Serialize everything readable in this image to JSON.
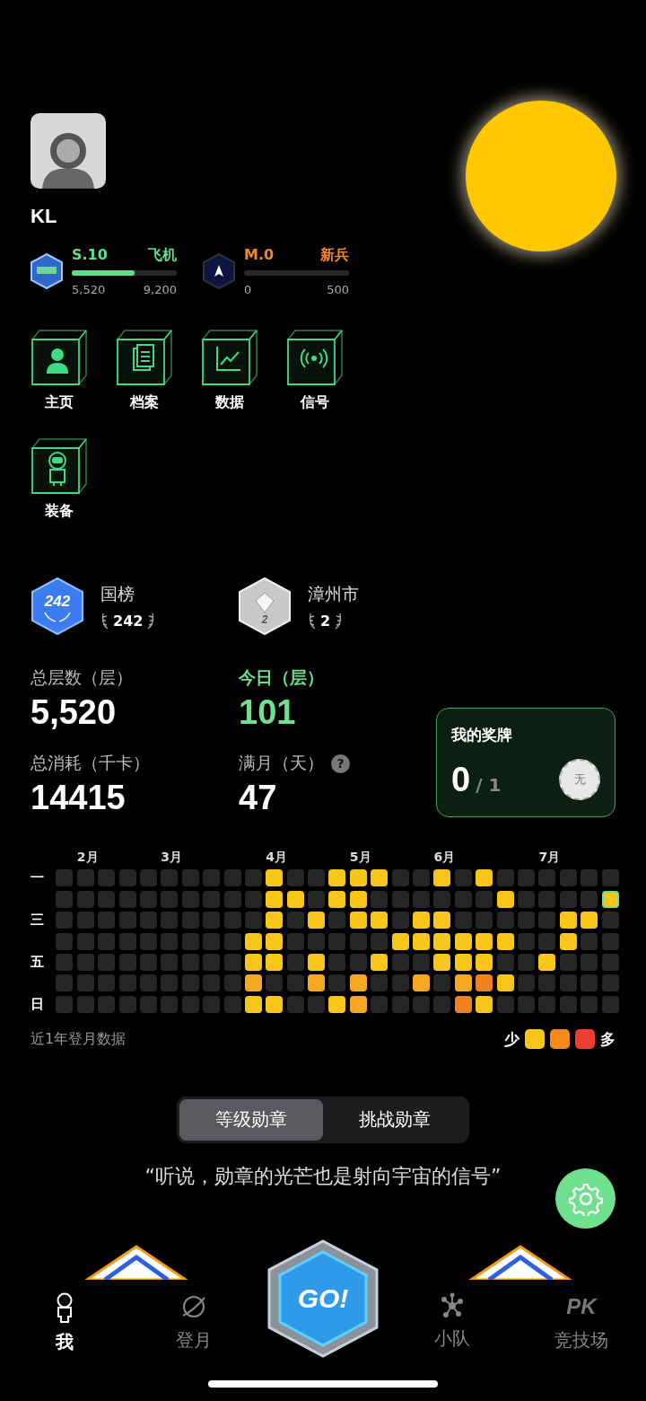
{
  "profile": {
    "name": "KL"
  },
  "levels": [
    {
      "kind": "emblem",
      "code": "S.10",
      "title": "飞机",
      "level": 0.6,
      "current": "5,520",
      "target": "9,200",
      "color": "#5fe08a"
    },
    {
      "kind": "arrow",
      "code": "M.0",
      "title": "新兵",
      "level": 0,
      "current": "0",
      "target": "500",
      "color": "#f08a24"
    }
  ],
  "menu": [
    {
      "kind": "person",
      "label": "主页"
    },
    {
      "kind": "document",
      "label": "档案"
    },
    {
      "kind": "chart",
      "label": "数据"
    },
    {
      "kind": "signal",
      "label": "信号"
    },
    {
      "kind": "astronaut",
      "label": "装备"
    }
  ],
  "rankings": [
    {
      "kind": "blue",
      "title": "国榜",
      "badge_text": "242",
      "rank": "242"
    },
    {
      "kind": "silver",
      "title": "漳州市",
      "badge_text": "2",
      "rank": "2"
    }
  ],
  "stats": [
    {
      "label": "总层数（层）",
      "value": "5,520",
      "highlight": false
    },
    {
      "label": "今日（层）",
      "value": "101",
      "highlight": true
    },
    {
      "label": "总消耗（千卡）",
      "value": "14415",
      "highlight": false
    },
    {
      "label": "满月（天）",
      "value": "47",
      "highlight": false,
      "help_text": "?"
    }
  ],
  "medal_card": {
    "title": "我的奖牌",
    "count": "0",
    "total": "/ 1",
    "medal_text": "无"
  },
  "heatmap": {
    "months": [
      "2月",
      "3月",
      "4月",
      "5月",
      "6月",
      "7月"
    ],
    "rows": [
      {
        "label": "一",
        "today": false,
        "cells": [
          {
            "color": "#262626"
          },
          {
            "color": "#262626"
          },
          {
            "color": "#262626"
          },
          {
            "color": "#262626"
          },
          {
            "color": "#262626"
          },
          {
            "color": "#262626"
          },
          {
            "color": "#262626"
          },
          {
            "color": "#262626"
          },
          {
            "color": "#262626"
          },
          {
            "color": "#262626"
          },
          {
            "color": "#f8c51b"
          },
          {
            "color": "#262626"
          },
          {
            "color": "#262626"
          },
          {
            "color": "#f8c51b"
          },
          {
            "color": "#f8c51b"
          },
          {
            "color": "#f8c51b"
          },
          {
            "color": "#262626"
          },
          {
            "color": "#262626"
          },
          {
            "color": "#f8c51b"
          },
          {
            "color": "#262626"
          },
          {
            "color": "#f8c51b"
          },
          {
            "color": "#262626"
          },
          {
            "color": "#262626"
          },
          {
            "color": "#262626"
          },
          {
            "color": "#262626"
          },
          {
            "color": "#262626"
          },
          {
            "color": "#262626"
          }
        ]
      },
      {
        "today": true,
        "cells": [
          {
            "color": "#262626"
          },
          {
            "color": "#262626"
          },
          {
            "color": "#262626"
          },
          {
            "color": "#262626"
          },
          {
            "color": "#262626"
          },
          {
            "color": "#262626"
          },
          {
            "color": "#262626"
          },
          {
            "color": "#262626"
          },
          {
            "color": "#262626"
          },
          {
            "color": "#262626"
          },
          {
            "color": "#f8c51b"
          },
          {
            "color": "#f8c51b"
          },
          {
            "color": "#262626"
          },
          {
            "color": "#f8c51b"
          },
          {
            "color": "#f8c51b"
          },
          {
            "color": "#262626"
          },
          {
            "color": "#262626"
          },
          {
            "color": "#262626"
          },
          {
            "color": "#262626"
          },
          {
            "color": "#262626"
          },
          {
            "color": "#262626"
          },
          {
            "color": "#f8c51b"
          },
          {
            "color": "#262626"
          },
          {
            "color": "#262626"
          },
          {
            "color": "#262626"
          },
          {
            "color": "#262626"
          },
          {
            "color": "#f8c51b"
          }
        ]
      },
      {
        "label": "三",
        "today": false,
        "cells": [
          {
            "color": "#262626"
          },
          {
            "color": "#262626"
          },
          {
            "color": "#262626"
          },
          {
            "color": "#262626"
          },
          {
            "color": "#262626"
          },
          {
            "color": "#262626"
          },
          {
            "color": "#262626"
          },
          {
            "color": "#262626"
          },
          {
            "color": "#262626"
          },
          {
            "color": "#262626"
          },
          {
            "color": "#f8c51b"
          },
          {
            "color": "#262626"
          },
          {
            "color": "#f8c51b"
          },
          {
            "color": "#262626"
          },
          {
            "color": "#f8c51b"
          },
          {
            "color": "#f8c51b"
          },
          {
            "color": "#262626"
          },
          {
            "color": "#f8c51b"
          },
          {
            "color": "#f8c51b"
          },
          {
            "color": "#262626"
          },
          {
            "color": "#262626"
          },
          {
            "color": "#262626"
          },
          {
            "color": "#262626"
          },
          {
            "color": "#262626"
          },
          {
            "color": "#f8c51b"
          },
          {
            "color": "#f8c51b"
          },
          {
            "color": "#262626"
          }
        ]
      },
      {
        "today": false,
        "cells": [
          {
            "color": "#262626"
          },
          {
            "color": "#262626"
          },
          {
            "color": "#262626"
          },
          {
            "color": "#262626"
          },
          {
            "color": "#262626"
          },
          {
            "color": "#262626"
          },
          {
            "color": "#262626"
          },
          {
            "color": "#262626"
          },
          {
            "color": "#262626"
          },
          {
            "color": "#f8c51b"
          },
          {
            "color": "#f8c51b"
          },
          {
            "color": "#262626"
          },
          {
            "color": "#262626"
          },
          {
            "color": "#262626"
          },
          {
            "color": "#262626"
          },
          {
            "color": "#262626"
          },
          {
            "color": "#f8c51b"
          },
          {
            "color": "#f8c51b"
          },
          {
            "color": "#f8c51b"
          },
          {
            "color": "#f8c51b"
          },
          {
            "color": "#f8c51b"
          },
          {
            "color": "#f8c51b"
          },
          {
            "color": "#262626"
          },
          {
            "color": "#262626"
          },
          {
            "color": "#f8c51b"
          },
          {
            "color": "#262626"
          },
          {
            "color": "#262626"
          }
        ]
      },
      {
        "label": "五",
        "today": false,
        "cells": [
          {
            "color": "#262626"
          },
          {
            "color": "#262626"
          },
          {
            "color": "#262626"
          },
          {
            "color": "#262626"
          },
          {
            "color": "#262626"
          },
          {
            "color": "#262626"
          },
          {
            "color": "#262626"
          },
          {
            "color": "#262626"
          },
          {
            "color": "#262626"
          },
          {
            "color": "#f8c51b"
          },
          {
            "color": "#f8c51b"
          },
          {
            "color": "#262626"
          },
          {
            "color": "#f8c51b"
          },
          {
            "color": "#262626"
          },
          {
            "color": "#262626"
          },
          {
            "color": "#f8c51b"
          },
          {
            "color": "#262626"
          },
          {
            "color": "#262626"
          },
          {
            "color": "#f8c51b"
          },
          {
            "color": "#f8c51b"
          },
          {
            "color": "#f8c51b"
          },
          {
            "color": "#262626"
          },
          {
            "color": "#262626"
          },
          {
            "color": "#f8c51b"
          },
          {
            "color": "#262626"
          },
          {
            "color": "#262626"
          },
          {
            "color": "#262626"
          }
        ]
      },
      {
        "today": false,
        "cells": [
          {
            "color": "#262626"
          },
          {
            "color": "#262626"
          },
          {
            "color": "#262626"
          },
          {
            "color": "#262626"
          },
          {
            "color": "#262626"
          },
          {
            "color": "#262626"
          },
          {
            "color": "#262626"
          },
          {
            "color": "#262626"
          },
          {
            "color": "#262626"
          },
          {
            "color": "#f7a822"
          },
          {
            "color": "#262626"
          },
          {
            "color": "#262626"
          },
          {
            "color": "#f7a822"
          },
          {
            "color": "#262626"
          },
          {
            "color": "#f7a822"
          },
          {
            "color": "#262626"
          },
          {
            "color": "#262626"
          },
          {
            "color": "#f7a822"
          },
          {
            "color": "#262626"
          },
          {
            "color": "#f7a822"
          },
          {
            "color": "#f0801e"
          },
          {
            "color": "#f8c51b"
          },
          {
            "color": "#262626"
          },
          {
            "color": "#262626"
          },
          {
            "color": "#262626"
          },
          {
            "color": "#262626"
          },
          {
            "color": "#262626"
          }
        ]
      },
      {
        "label": "日",
        "today": false,
        "cells": [
          {
            "color": "#262626"
          },
          {
            "color": "#262626"
          },
          {
            "color": "#262626"
          },
          {
            "color": "#262626"
          },
          {
            "color": "#262626"
          },
          {
            "color": "#262626"
          },
          {
            "color": "#262626"
          },
          {
            "color": "#262626"
          },
          {
            "color": "#262626"
          },
          {
            "color": "#f8c51b"
          },
          {
            "color": "#f8c51b"
          },
          {
            "color": "#262626"
          },
          {
            "color": "#262626"
          },
          {
            "color": "#f8c51b"
          },
          {
            "color": "#f7a822"
          },
          {
            "color": "#262626"
          },
          {
            "color": "#262626"
          },
          {
            "color": "#262626"
          },
          {
            "color": "#262626"
          },
          {
            "color": "#f0801e"
          },
          {
            "color": "#f8c51b"
          },
          {
            "color": "#262626"
          },
          {
            "color": "#262626"
          },
          {
            "color": "#262626"
          },
          {
            "color": "#262626"
          },
          {
            "color": "#262626"
          },
          {
            "color": "#262626"
          }
        ]
      }
    ],
    "caption": "近1年登月数据",
    "legend": {
      "low": "少",
      "high": "多",
      "swatches": [
        {
          "color": "#f8c51b"
        },
        {
          "color": "#f58a1a"
        },
        {
          "color": "#ee3d33"
        }
      ]
    }
  },
  "segments": [
    {
      "label": "等级勋章",
      "selected": true
    },
    {
      "label": "挑战勋章",
      "selected": false
    }
  ],
  "quote": "“听说，勋章的光芒也是射向宇宙的信号”",
  "go_button": {
    "label": "GO!"
  },
  "tabs": [
    {
      "kind": "astronaut",
      "label": "我",
      "selected": true
    },
    {
      "kind": "planet",
      "label": "登月",
      "selected": false
    },
    {
      "kind": "network",
      "label": "小队",
      "selected": false
    },
    {
      "kind": "pk",
      "icon_text": "PK",
      "label": "竞技场",
      "selected": false
    }
  ]
}
